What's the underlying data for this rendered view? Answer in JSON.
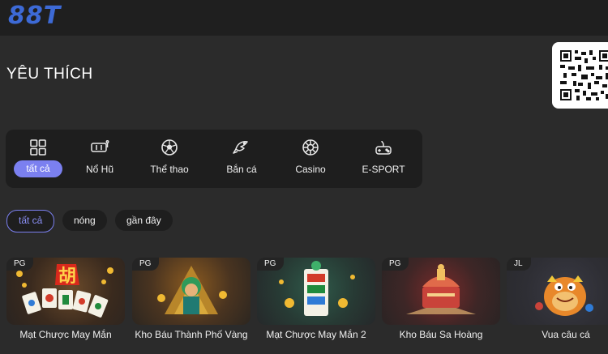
{
  "brand": {
    "logo": "88T"
  },
  "page": {
    "title": "YÊU THÍCH"
  },
  "categories": [
    {
      "label": "tất cả",
      "icon": "grid-icon",
      "active": true
    },
    {
      "label": "Nổ Hũ",
      "icon": "slot-machine-icon"
    },
    {
      "label": "Thể thao",
      "icon": "soccer-ball-icon"
    },
    {
      "label": "Bắn cá",
      "icon": "fish-icon"
    },
    {
      "label": "Casino",
      "icon": "roulette-wheel-icon"
    },
    {
      "label": "E-SPORT",
      "icon": "gamepad-icon"
    }
  ],
  "filters": [
    {
      "label": "tất cả",
      "active": true
    },
    {
      "label": "nóng"
    },
    {
      "label": "gần đây"
    }
  ],
  "games": [
    {
      "provider": "PG",
      "name": "Mạt Chược May Mắn"
    },
    {
      "provider": "PG",
      "name": "Kho Báu Thành Phố Vàng"
    },
    {
      "provider": "PG",
      "name": "Mạt Chược May Mắn 2"
    },
    {
      "provider": "PG",
      "name": "Kho Báu Sa Hoàng"
    },
    {
      "provider": "JL",
      "name": "Vua câu cá"
    }
  ],
  "colors": {
    "accent": "#7b80f0",
    "logo": "#3d6ad6",
    "background": "#2b2b2b",
    "panel": "#1e1e1e"
  }
}
